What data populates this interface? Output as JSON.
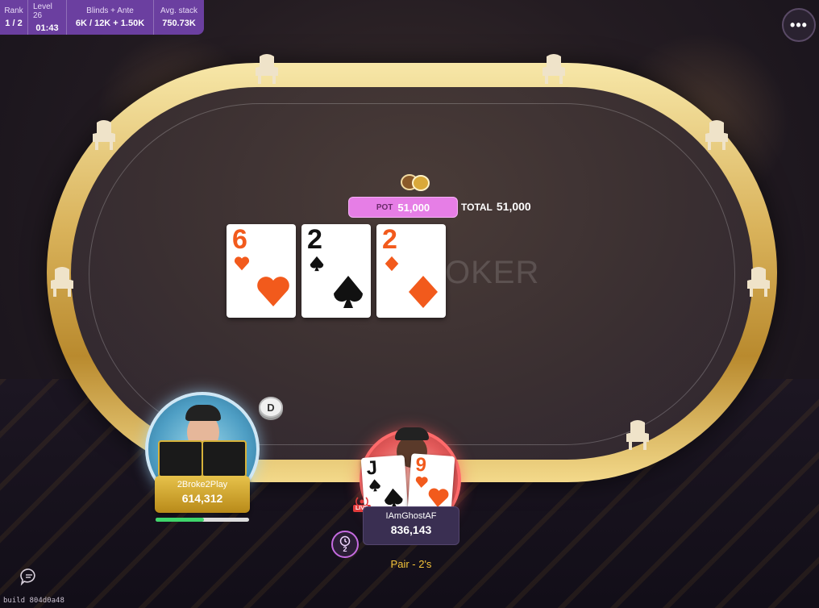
{
  "hud": {
    "rank_label": "Rank",
    "rank_value": "1 / 2",
    "level_label": "Level 26",
    "level_value": "01:43",
    "blinds_label": "Blinds + Ante",
    "blinds_value": "6K / 12K + 1.50K",
    "avg_label": "Avg. stack",
    "avg_value": "750.73K"
  },
  "menu": {
    "icon": "more-dots-icon",
    "glyph": "•••"
  },
  "table": {
    "watermark": "MPOKER"
  },
  "pot": {
    "label": "POT",
    "value": "51,000",
    "total_label": "TOTAL",
    "total_value": "51,000"
  },
  "board": [
    {
      "rank": "6",
      "suit": "hearts",
      "color": "orange"
    },
    {
      "rank": "2",
      "suit": "spades",
      "color": "black"
    },
    {
      "rank": "2",
      "suit": "diamonds",
      "color": "orange"
    }
  ],
  "dealer_button": "D",
  "players": {
    "opponent": {
      "name": "2Broke2Play",
      "stack": "614,312",
      "timer_fraction": 0.52
    },
    "hero": {
      "name": "IAmGhostAF",
      "stack": "836,143",
      "live": "LIVE",
      "hand_description": "Pair - 2's",
      "cards": [
        {
          "rank": "J",
          "suit": "spades",
          "color": "black"
        },
        {
          "rank": "9",
          "suit": "hearts",
          "color": "orange"
        }
      ]
    }
  },
  "timebank": {
    "count": "2"
  },
  "build": "build 804d0a48",
  "colors": {
    "hud": "#6b3fa0",
    "pot_pill": "#e67ee6",
    "rail_gold": "#d9b25a",
    "suit_red": "#f25a1c",
    "hand_text": "#f5c43a"
  }
}
